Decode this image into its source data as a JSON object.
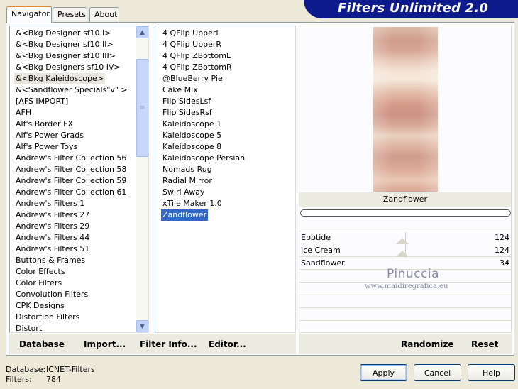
{
  "tabs": [
    {
      "label": "Navigator"
    },
    {
      "label": "Presets"
    },
    {
      "label": "About"
    }
  ],
  "banner": {
    "title": "Filters Unlimited 2.0"
  },
  "categories": [
    "&<Bkg Designer sf10 I>",
    "&<Bkg Designer sf10 II>",
    "&<Bkg Designer sf10 III>",
    "&<Bkg Designers sf10 IV>",
    "&<Bkg Kaleidoscope>",
    "&<Sandflower Specials\"v\" >",
    "[AFS IMPORT]",
    "AFH",
    "Alf's Border FX",
    "Alf's Power Grads",
    "Alf's Power Toys",
    "Andrew's Filter Collection 56",
    "Andrew's Filter Collection 58",
    "Andrew's Filter Collection 59",
    "Andrew's Filter Collection 61",
    "Andrew's Filters 1",
    "Andrew's Filters 27",
    "Andrew's Filters 29",
    "Andrew's Filters 44",
    "Andrew's Filters 51",
    "Buttons & Frames",
    "Color Effects",
    "Color Filters",
    "Convolution Filters",
    "CPK Designs",
    "Distortion Filters",
    "Distort"
  ],
  "filters": [
    "4 QFlip UpperL",
    "4 QFlip UpperR",
    "4 QFlip ZBottomL",
    "4 QFlip ZBottomR",
    "@BlueBerry Pie",
    "Cake Mix",
    "Flip SidesLsf",
    "Flip SidesRsf",
    "Kaleidoscope 1",
    "Kaleidoscope 5",
    "Kaleidoscope 8",
    "Kaleidoscope Persian",
    "Nomads Rug",
    "Radial Mirror",
    "Swirl Away",
    "xTile Maker 1.0",
    "Zandflower"
  ],
  "preview": {
    "filter_name": "Zandflower"
  },
  "params": [
    {
      "label": "Ebbtide",
      "value": "124"
    },
    {
      "label": "Ice Cream",
      "value": "124"
    },
    {
      "label": "Sandflower",
      "value": "34"
    }
  ],
  "watermark": {
    "name": "Pinuccia",
    "url": "www.maidiregrafica.eu"
  },
  "toolbar": {
    "database": "Database",
    "import": "Import...",
    "filter_info": "Filter Info...",
    "editor": "Editor...",
    "randomize": "Randomize",
    "reset": "Reset"
  },
  "status": {
    "database_label": "Database:",
    "database_value": "ICNET-Filters",
    "filters_label": "Filters:",
    "filters_value": "784"
  },
  "buttons": {
    "apply": "Apply",
    "cancel": "Cancel",
    "help": "Help"
  },
  "colors": {
    "banner": "#0c1a8c",
    "selection": "#316ac5",
    "tab_accent": "#e68b2c"
  }
}
